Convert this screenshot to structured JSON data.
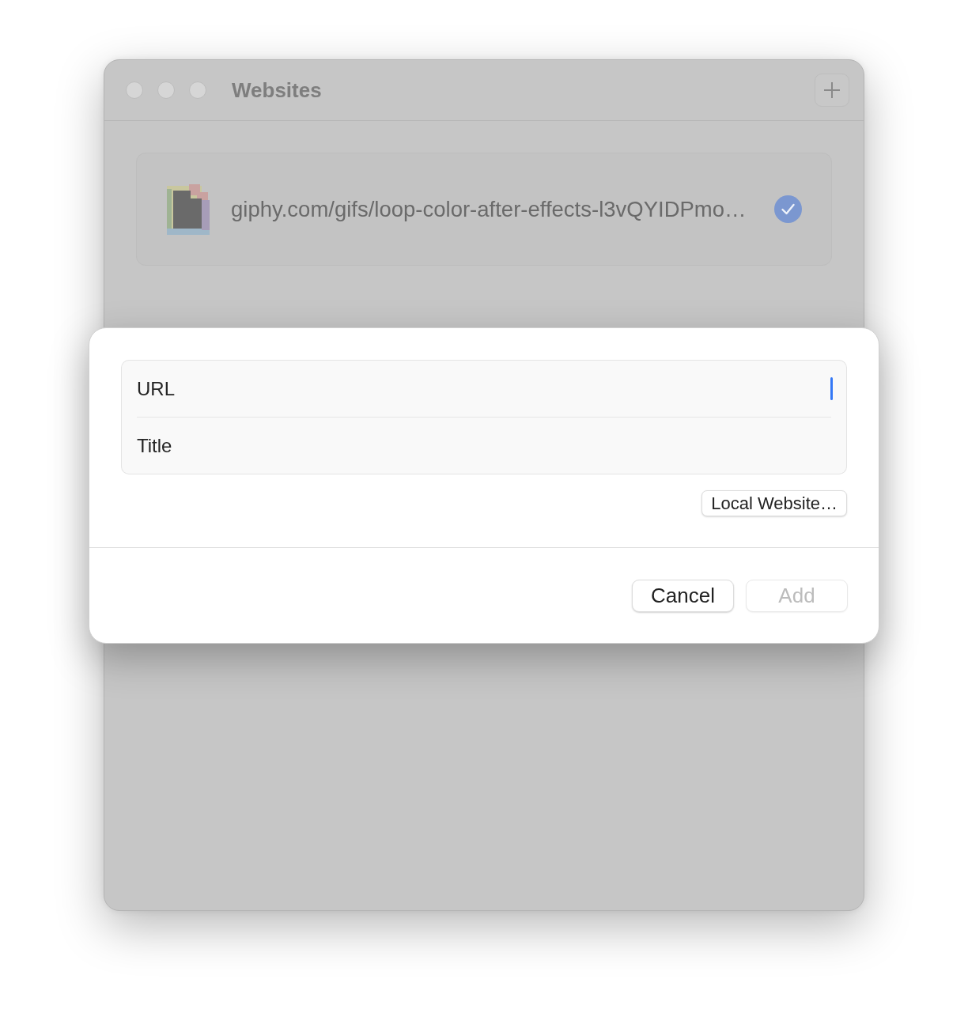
{
  "window": {
    "title": "Websites"
  },
  "websites": [
    {
      "url": "giphy.com/gifs/loop-color-after-effects-l3vQYIDPmo…",
      "checked": true
    }
  ],
  "sheet": {
    "fields": [
      {
        "placeholder": "URL",
        "focused": true
      },
      {
        "placeholder": "Title",
        "focused": false
      }
    ],
    "local_button": "Local Website…",
    "buttons": [
      {
        "label": "Cancel",
        "disabled": false
      },
      {
        "label": "Add",
        "disabled": true
      }
    ]
  }
}
